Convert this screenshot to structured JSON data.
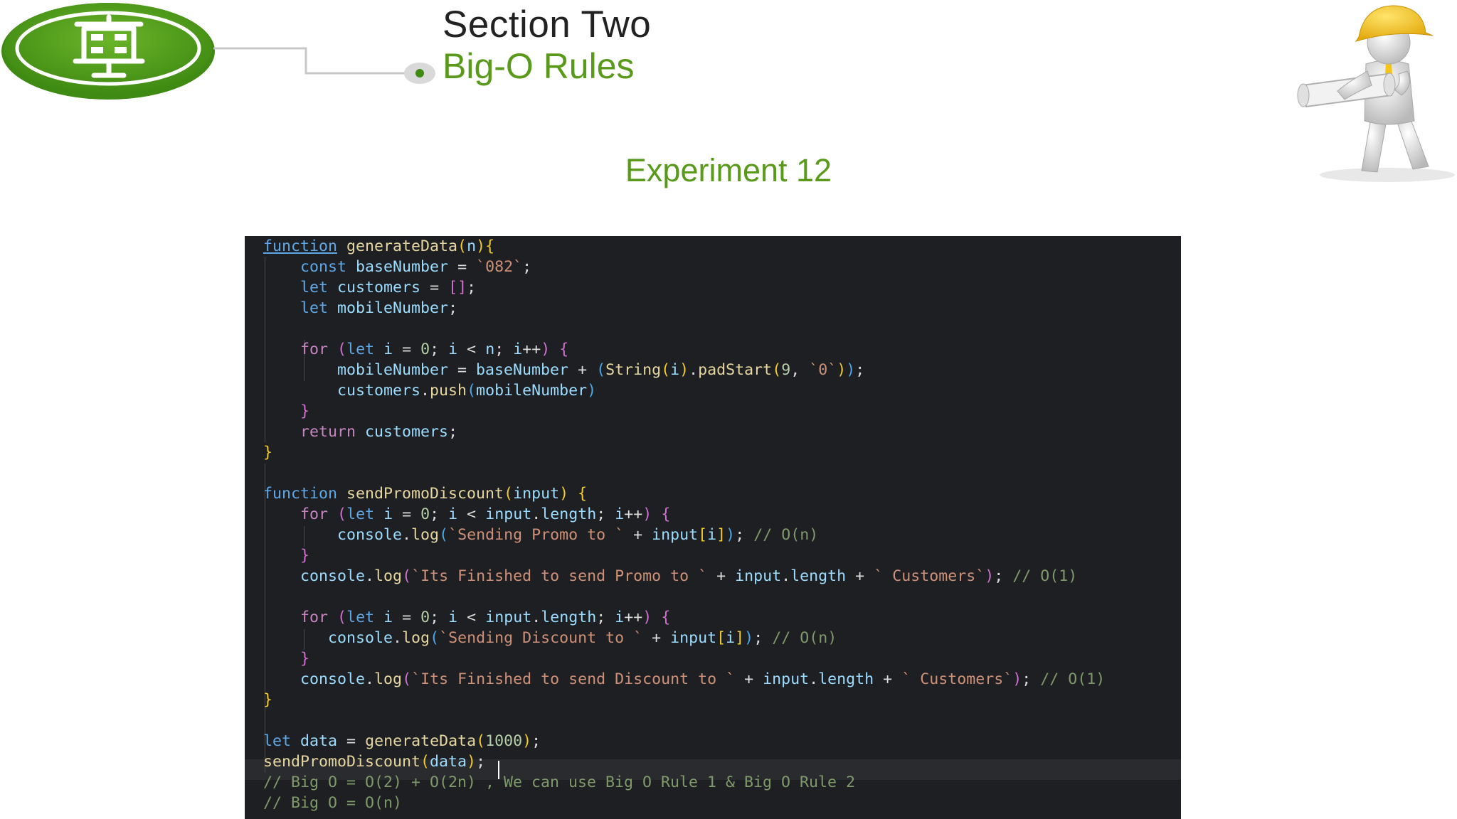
{
  "header": {
    "section_title": "Section Two",
    "section_subtitle": "Big-O Rules",
    "experiment_title": "Experiment 12"
  },
  "icons": {
    "logo": "presentation-board-icon",
    "figure": "construction-worker-with-blueprint"
  },
  "colors": {
    "accent_green": "#5a9a1b",
    "editor_background": "#1e1f22"
  },
  "code": {
    "lines": [
      [
        [
          "function",
          "kw-u"
        ],
        [
          " "
        ],
        [
          "generateData",
          "fn"
        ],
        [
          "(",
          "p1"
        ],
        [
          "n",
          "var"
        ],
        [
          ")",
          "p1"
        ],
        [
          "{",
          "p1"
        ]
      ],
      [
        [
          "    "
        ],
        [
          "const",
          "kw"
        ],
        [
          " "
        ],
        [
          "baseNumber",
          "var"
        ],
        [
          " = "
        ],
        [
          "`082`",
          "str"
        ],
        [
          ";"
        ]
      ],
      [
        [
          "    "
        ],
        [
          "let",
          "kw"
        ],
        [
          " "
        ],
        [
          "customers",
          "var"
        ],
        [
          " = "
        ],
        [
          "[]",
          "p2"
        ],
        [
          ";"
        ]
      ],
      [
        [
          "    "
        ],
        [
          "let",
          "kw"
        ],
        [
          " "
        ],
        [
          "mobileNumber",
          "var"
        ],
        [
          ";"
        ]
      ],
      [
        [
          ""
        ]
      ],
      [
        [
          "    "
        ],
        [
          "for",
          "ctrl"
        ],
        [
          " "
        ],
        [
          "(",
          "p2"
        ],
        [
          "let",
          "kw"
        ],
        [
          " "
        ],
        [
          "i",
          "var"
        ],
        [
          " = "
        ],
        [
          "0",
          "num"
        ],
        [
          "; "
        ],
        [
          "i",
          "var"
        ],
        [
          " < "
        ],
        [
          "n",
          "var"
        ],
        [
          "; "
        ],
        [
          "i",
          "var"
        ],
        [
          "++"
        ],
        [
          ")",
          "p2"
        ],
        [
          " "
        ],
        [
          "{",
          "p2"
        ]
      ],
      [
        [
          "        "
        ],
        [
          "mobileNumber",
          "var"
        ],
        [
          " = "
        ],
        [
          "baseNumber",
          "var"
        ],
        [
          " + "
        ],
        [
          "(",
          "p3"
        ],
        [
          "String",
          "fn"
        ],
        [
          "(",
          "p1"
        ],
        [
          "i",
          "var"
        ],
        [
          ")",
          "p1"
        ],
        [
          "."
        ],
        [
          "padStart",
          "fn"
        ],
        [
          "(",
          "p1"
        ],
        [
          "9",
          "num"
        ],
        [
          ", "
        ],
        [
          "`0`",
          "str"
        ],
        [
          ")",
          "p1"
        ],
        [
          ")",
          "p3"
        ],
        [
          ";"
        ]
      ],
      [
        [
          "        "
        ],
        [
          "customers",
          "var"
        ],
        [
          "."
        ],
        [
          "push",
          "fn"
        ],
        [
          "(",
          "p3"
        ],
        [
          "mobileNumber",
          "var"
        ],
        [
          ")",
          "p3"
        ]
      ],
      [
        [
          "    "
        ],
        [
          "}",
          "p2"
        ]
      ],
      [
        [
          "    "
        ],
        [
          "return",
          "ctrl"
        ],
        [
          " "
        ],
        [
          "customers",
          "var"
        ],
        [
          ";"
        ]
      ],
      [
        [
          "}",
          "p1"
        ]
      ],
      [
        [
          ""
        ]
      ],
      [
        [
          "function",
          "kw"
        ],
        [
          " "
        ],
        [
          "sendPromoDiscount",
          "fn"
        ],
        [
          "(",
          "p1"
        ],
        [
          "input",
          "var"
        ],
        [
          ")",
          "p1"
        ],
        [
          " "
        ],
        [
          "{",
          "p1"
        ]
      ],
      [
        [
          "    "
        ],
        [
          "for",
          "ctrl"
        ],
        [
          " "
        ],
        [
          "(",
          "p2"
        ],
        [
          "let",
          "kw"
        ],
        [
          " "
        ],
        [
          "i",
          "var"
        ],
        [
          " = "
        ],
        [
          "0",
          "num"
        ],
        [
          "; "
        ],
        [
          "i",
          "var"
        ],
        [
          " < "
        ],
        [
          "input",
          "var"
        ],
        [
          "."
        ],
        [
          "length",
          "var"
        ],
        [
          "; "
        ],
        [
          "i",
          "var"
        ],
        [
          "++"
        ],
        [
          ")",
          "p2"
        ],
        [
          " "
        ],
        [
          "{",
          "p2"
        ]
      ],
      [
        [
          "        "
        ],
        [
          "console",
          "var"
        ],
        [
          "."
        ],
        [
          "log",
          "fn"
        ],
        [
          "(",
          "p3"
        ],
        [
          "`Sending Promo to `",
          "str"
        ],
        [
          " + "
        ],
        [
          "input",
          "var"
        ],
        [
          "[",
          "p1"
        ],
        [
          "i",
          "var"
        ],
        [
          "]",
          "p1"
        ],
        [
          ")",
          "p3"
        ],
        [
          "; "
        ],
        [
          "// O(n)",
          "cm"
        ]
      ],
      [
        [
          "    "
        ],
        [
          "}",
          "p2"
        ]
      ],
      [
        [
          "    "
        ],
        [
          "console",
          "var"
        ],
        [
          "."
        ],
        [
          "log",
          "fn"
        ],
        [
          "(",
          "p2"
        ],
        [
          "`Its Finished to send Promo to `",
          "str"
        ],
        [
          " + "
        ],
        [
          "input",
          "var"
        ],
        [
          "."
        ],
        [
          "length",
          "var"
        ],
        [
          " + "
        ],
        [
          "` Customers`",
          "str"
        ],
        [
          ")",
          "p2"
        ],
        [
          "; "
        ],
        [
          "// O(1)",
          "cm"
        ]
      ],
      [
        [
          ""
        ]
      ],
      [
        [
          "    "
        ],
        [
          "for",
          "ctrl"
        ],
        [
          " "
        ],
        [
          "(",
          "p2"
        ],
        [
          "let",
          "kw"
        ],
        [
          " "
        ],
        [
          "i",
          "var"
        ],
        [
          " = "
        ],
        [
          "0",
          "num"
        ],
        [
          "; "
        ],
        [
          "i",
          "var"
        ],
        [
          " < "
        ],
        [
          "input",
          "var"
        ],
        [
          "."
        ],
        [
          "length",
          "var"
        ],
        [
          "; "
        ],
        [
          "i",
          "var"
        ],
        [
          "++"
        ],
        [
          ")",
          "p2"
        ],
        [
          " "
        ],
        [
          "{",
          "p2"
        ]
      ],
      [
        [
          "       "
        ],
        [
          "console",
          "var"
        ],
        [
          "."
        ],
        [
          "log",
          "fn"
        ],
        [
          "(",
          "p3"
        ],
        [
          "`Sending Discount to `",
          "str"
        ],
        [
          " + "
        ],
        [
          "input",
          "var"
        ],
        [
          "[",
          "p1"
        ],
        [
          "i",
          "var"
        ],
        [
          "]",
          "p1"
        ],
        [
          ")",
          "p3"
        ],
        [
          "; "
        ],
        [
          "// O(n)",
          "cm"
        ]
      ],
      [
        [
          "    "
        ],
        [
          "}",
          "p2"
        ]
      ],
      [
        [
          "    "
        ],
        [
          "console",
          "var"
        ],
        [
          "."
        ],
        [
          "log",
          "fn"
        ],
        [
          "(",
          "p2"
        ],
        [
          "`Its Finished to send Discount to `",
          "str"
        ],
        [
          " + "
        ],
        [
          "input",
          "var"
        ],
        [
          "."
        ],
        [
          "length",
          "var"
        ],
        [
          " + "
        ],
        [
          "` Customers`",
          "str"
        ],
        [
          ")",
          "p2"
        ],
        [
          "; "
        ],
        [
          "// O(1)",
          "cm"
        ]
      ],
      [
        [
          "}",
          "p1"
        ]
      ],
      [
        [
          ""
        ]
      ],
      [
        [
          "let",
          "kw"
        ],
        [
          " "
        ],
        [
          "data",
          "var"
        ],
        [
          " = "
        ],
        [
          "generateData",
          "fn"
        ],
        [
          "(",
          "p1"
        ],
        [
          "1000",
          "num"
        ],
        [
          ")",
          "p1"
        ],
        [
          ";"
        ]
      ],
      [
        [
          "sendPromoDiscount",
          "fn"
        ],
        [
          "(",
          "p1"
        ],
        [
          "data",
          "var"
        ],
        [
          ")",
          "p1"
        ],
        [
          ";"
        ]
      ],
      [
        [
          "// Big O = O(2) + O(2n) , We can use Big O Rule 1 & Big O Rule 2",
          "cm"
        ]
      ],
      [
        [
          "// Big O = O(n)",
          "cm"
        ]
      ]
    ]
  }
}
